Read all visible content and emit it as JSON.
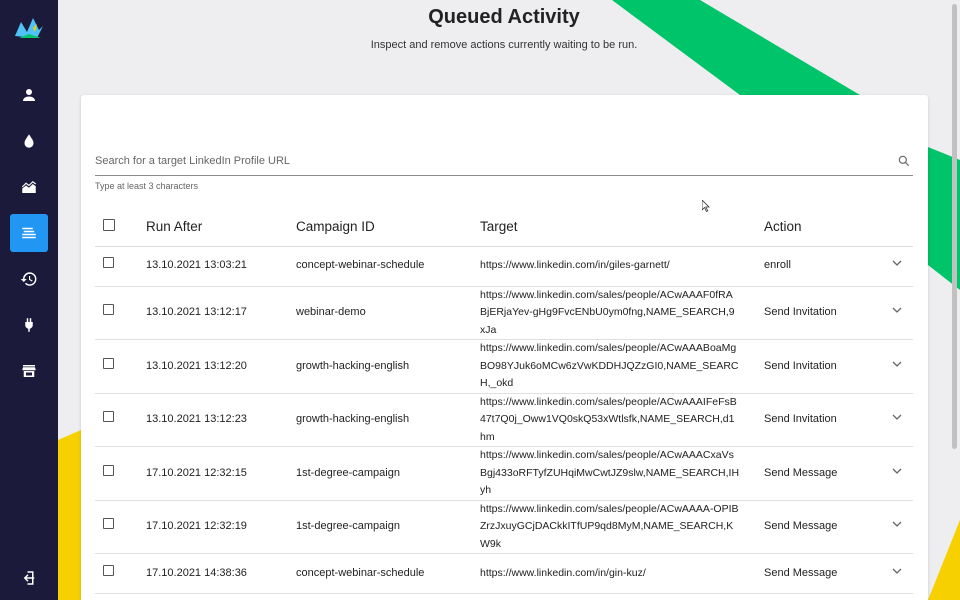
{
  "header": {
    "title": "Queued Activity",
    "subtitle": "Inspect and remove actions currently waiting to be run."
  },
  "search": {
    "placeholder": "Search for a target LinkedIn Profile URL",
    "helper": "Type at least 3 characters"
  },
  "table": {
    "columns": [
      "Run After",
      "Campaign ID",
      "Target",
      "Action"
    ],
    "rows": [
      {
        "run_after": "13.10.2021 13:03:21",
        "campaign": "concept-webinar-schedule",
        "target": "https://www.linkedin.com/in/giles-garnett/",
        "action": "enroll"
      },
      {
        "run_after": "13.10.2021 13:12:17",
        "campaign": "webinar-demo",
        "target": "https://www.linkedin.com/sales/people/ACwAAAF0fRA\nBjERjaYev-gHg9FvcENbU0ym0fng,NAME_SEARCH,9\nxJa",
        "action": "Send Invitation"
      },
      {
        "run_after": "13.10.2021 13:12:20",
        "campaign": "growth-hacking-english",
        "target": "https://www.linkedin.com/sales/people/ACwAAABoaMg\nBO98YJuk6oMCw6zVwKDDHJQZzGI0,NAME_SEARC\nH,_okd",
        "action": "Send Invitation"
      },
      {
        "run_after": "13.10.2021 13:12:23",
        "campaign": "growth-hacking-english",
        "target": "https://www.linkedin.com/sales/people/ACwAAAIFeFsB\n47t7Q0j_Oww1VQ0skQ53xWtlsfk,NAME_SEARCH,d1\nhm",
        "action": "Send Invitation"
      },
      {
        "run_after": "17.10.2021 12:32:15",
        "campaign": "1st-degree-campaign",
        "target": "https://www.linkedin.com/sales/people/ACwAAACxaVs\nBgj433oRFTyfZUHqiMwCwtJZ9slw,NAME_SEARCH,IH\nyh",
        "action": "Send Message"
      },
      {
        "run_after": "17.10.2021 12:32:19",
        "campaign": "1st-degree-campaign",
        "target": "https://www.linkedin.com/sales/people/ACwAAAA-OPIB\nZrzJxuyGCjDACkkITfUP9qd8MyM,NAME_SEARCH,K\nW9k",
        "action": "Send Message"
      },
      {
        "run_after": "17.10.2021 14:38:36",
        "campaign": "concept-webinar-schedule",
        "target": "https://www.linkedin.com/in/gin-kuz/",
        "action": "Send Message"
      }
    ]
  },
  "sidebar": {
    "items": [
      {
        "icon": "person-icon"
      },
      {
        "icon": "drop-icon"
      },
      {
        "icon": "chart-area-icon"
      },
      {
        "icon": "queue-list-icon",
        "active": true
      },
      {
        "icon": "history-icon"
      },
      {
        "icon": "plug-icon"
      },
      {
        "icon": "storefront-icon"
      }
    ],
    "logout_icon": "logout-icon"
  },
  "colors": {
    "sidebar_bg": "#1c1a3a",
    "active_item": "#2196f3",
    "accent_green": "#00c46a",
    "accent_yellow": "#f7d000"
  }
}
